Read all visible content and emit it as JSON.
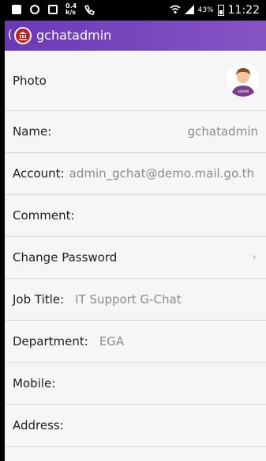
{
  "status_bar": {
    "speed": "0.4\nk/s",
    "battery_pct": "43%",
    "time": "11:22"
  },
  "app_bar": {
    "back_glyph": "(",
    "title": "gchatadmin"
  },
  "profile": {
    "photo_label": "Photo",
    "avatar_badge": "ADMIN",
    "name_label": "Name:",
    "name_value": "gchatadmin",
    "account_label": "Account:",
    "account_value": "admin_gchat@demo.mail.go.th",
    "comment_label": "Comment:",
    "change_password_label": "Change Password",
    "chevron": "›",
    "job_title_label": "Job Title:",
    "job_title_value": "IT Support G-Chat",
    "department_label": "Department:",
    "department_value": "EGA",
    "mobile_label": "Mobile:",
    "address_label": "Address:"
  },
  "colors": {
    "appbar_start": "#6a3ab6",
    "appbar_end": "#8754c4",
    "avatar_shirt": "#7a3d8a"
  }
}
